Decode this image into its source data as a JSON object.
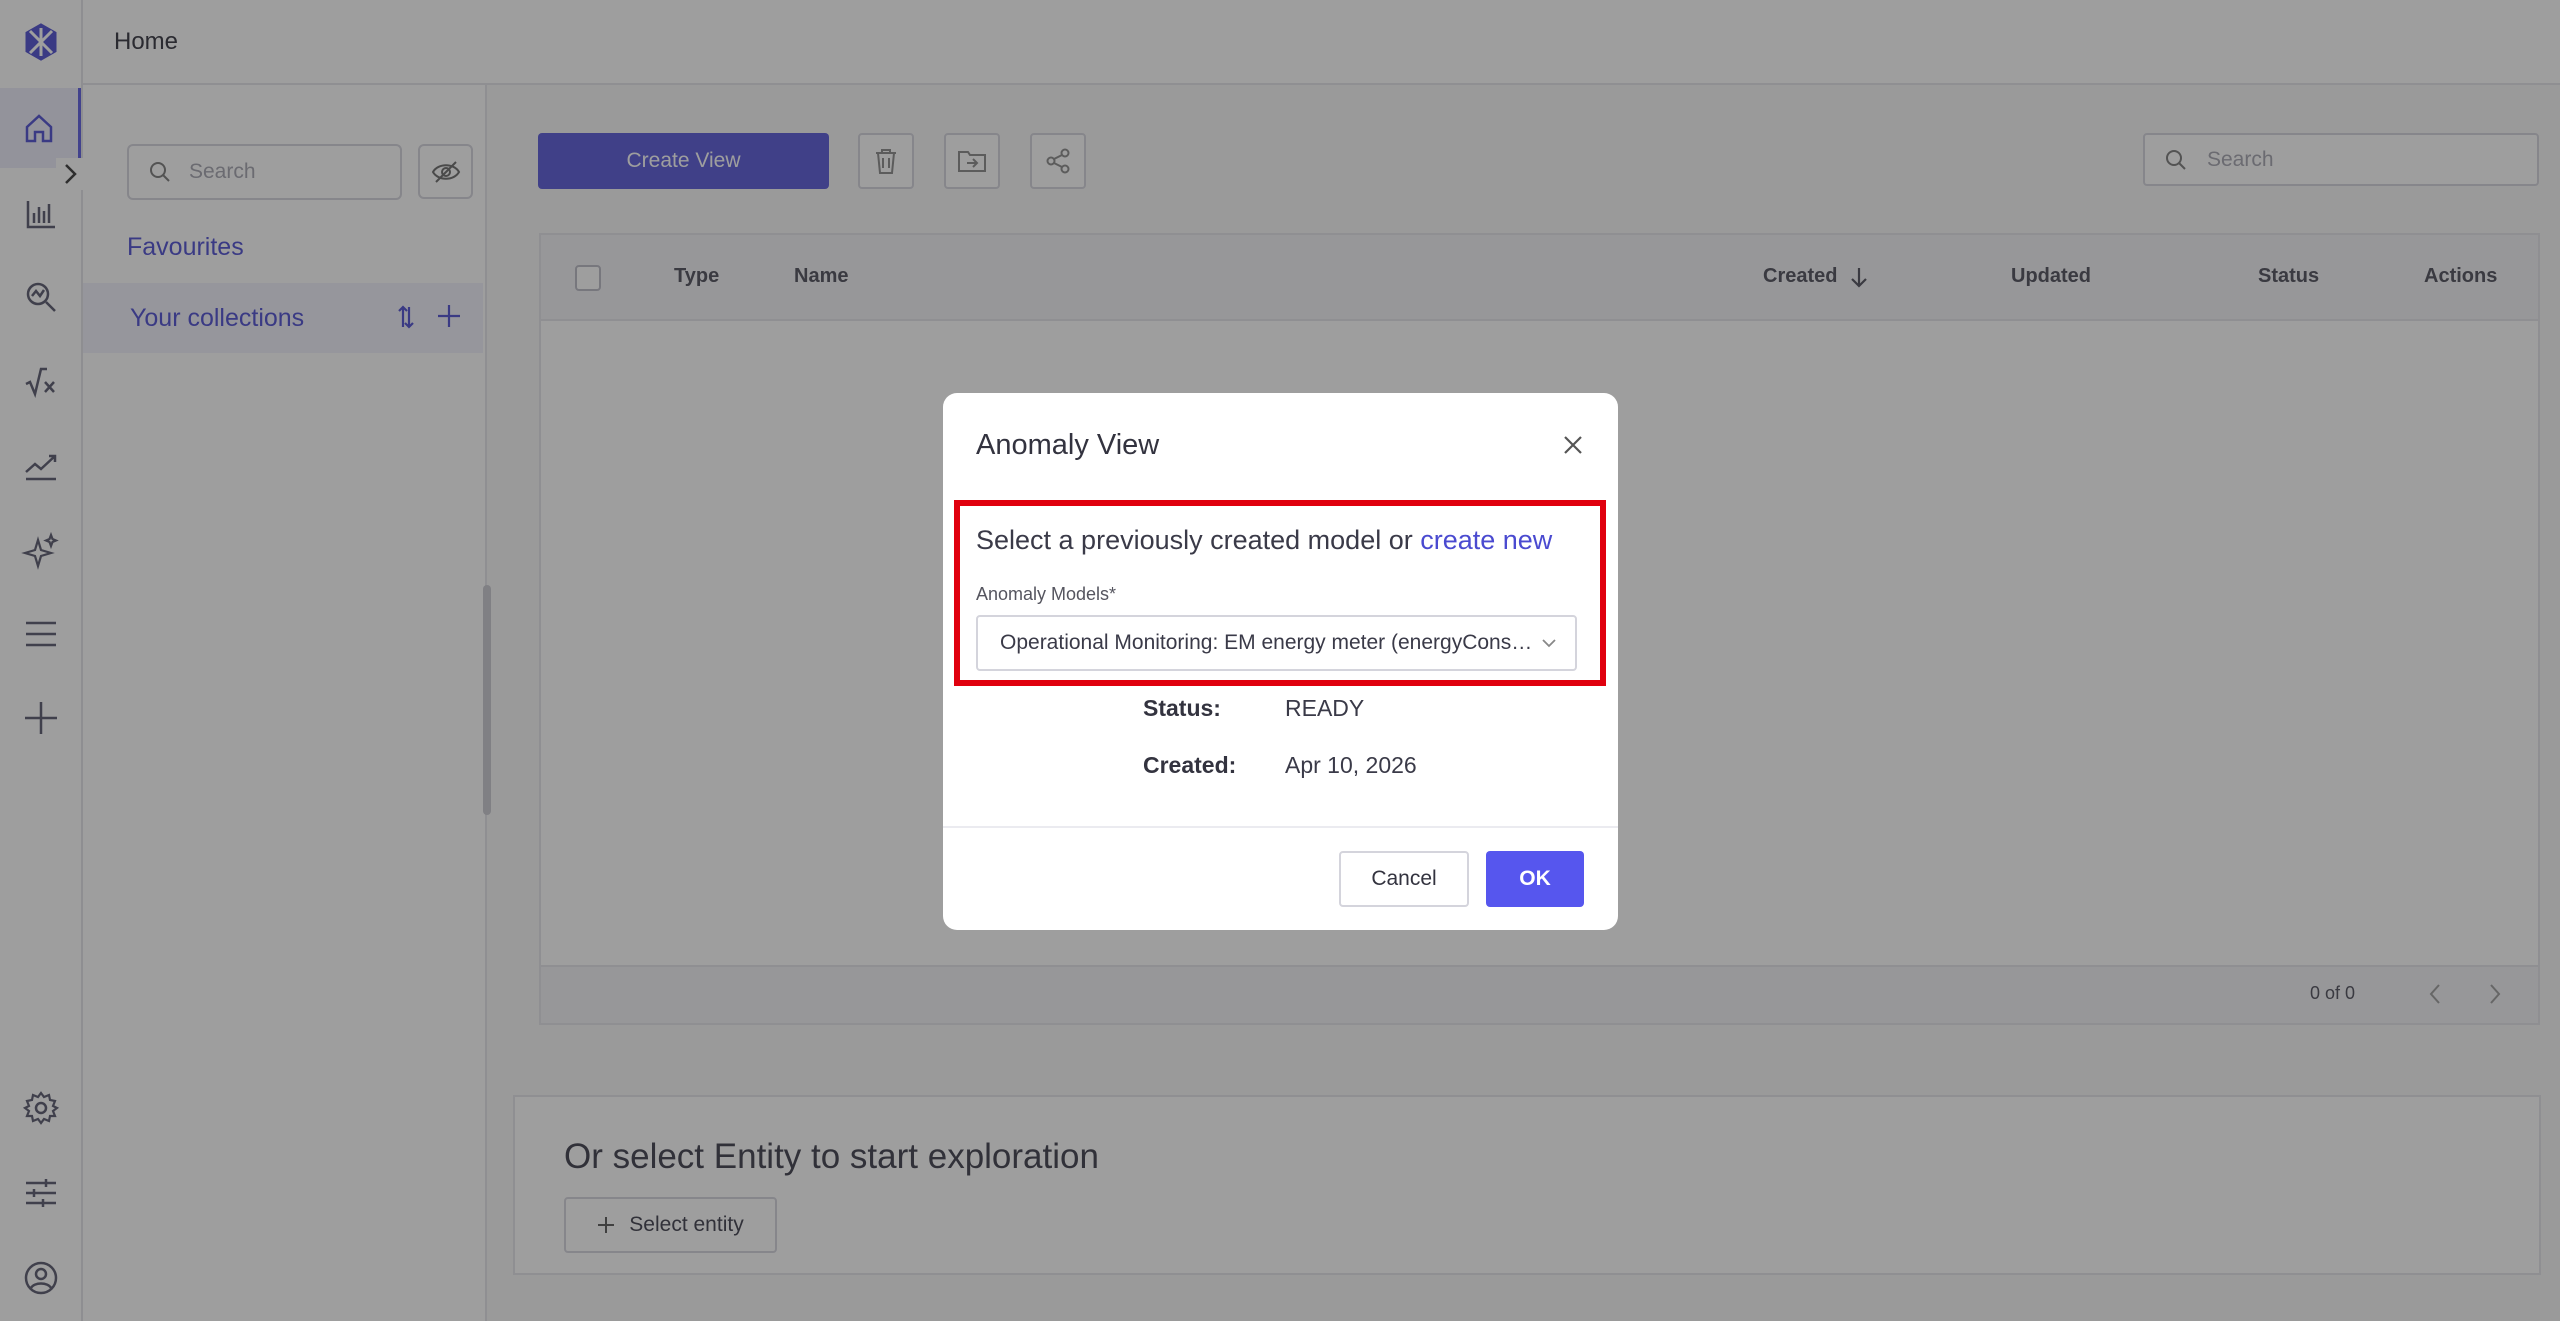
{
  "topbar": {
    "breadcrumb": "Home"
  },
  "rail": {
    "items": [
      "home-icon",
      "bar-chart-icon",
      "explore-icon",
      "formula-icon",
      "trend-icon",
      "sparkle-icon",
      "menu-icon",
      "plus-icon"
    ],
    "bottom": [
      "gear-icon",
      "sliders-icon",
      "user-icon"
    ]
  },
  "sidebar": {
    "search_placeholder": "Search",
    "favourites_label": "Favourites",
    "collections_label": "Your collections"
  },
  "toolbar": {
    "create_view_label": "Create View",
    "search_placeholder": "Search"
  },
  "table": {
    "headers": {
      "type": "Type",
      "name": "Name",
      "created": "Created",
      "updated": "Updated",
      "status": "Status",
      "actions": "Actions"
    },
    "pagination": "0 of 0"
  },
  "explore": {
    "title": "Or select Entity to start exploration",
    "select_entity_label": "Select entity"
  },
  "modal": {
    "title": "Anomaly View",
    "prompt_text": "Select a previously created model or ",
    "prompt_link": "create new",
    "field_label": "Anomaly Models*",
    "selected_model": "Operational Monitoring: EM energy meter (energyConsumption)",
    "status_label": "Status:",
    "status_value": "READY",
    "created_label": "Created:",
    "created_value": "Apr 10, 2026",
    "cancel_label": "Cancel",
    "ok_label": "OK"
  },
  "colors": {
    "accent": "#5454d8",
    "highlight": "#e0000e"
  }
}
